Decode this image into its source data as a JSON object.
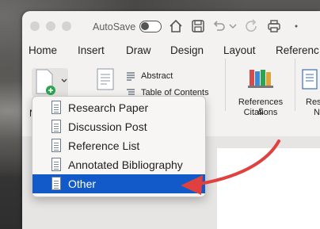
{
  "titlebar": {
    "autosave_label": "AutoSave"
  },
  "tabs": [
    "Home",
    "Insert",
    "Draw",
    "Design",
    "Layout",
    "Referenc"
  ],
  "ribbon": {
    "small_items": [
      "Abstract",
      "Table of Contents"
    ],
    "references_label_1": "References &",
    "references_label_2": "Citations",
    "partial_label_1": "Res",
    "partial_label_2": "N",
    "partial_left_letter": "N"
  },
  "menu": {
    "items": [
      {
        "label": "Research Paper"
      },
      {
        "label": "Discussion Post"
      },
      {
        "label": "Reference List"
      },
      {
        "label": "Annotated Bibliography"
      },
      {
        "label": "Other"
      }
    ],
    "selected_index": 4
  },
  "colors": {
    "selection": "#1259c9",
    "annotation_arrow": "#e0413f"
  }
}
